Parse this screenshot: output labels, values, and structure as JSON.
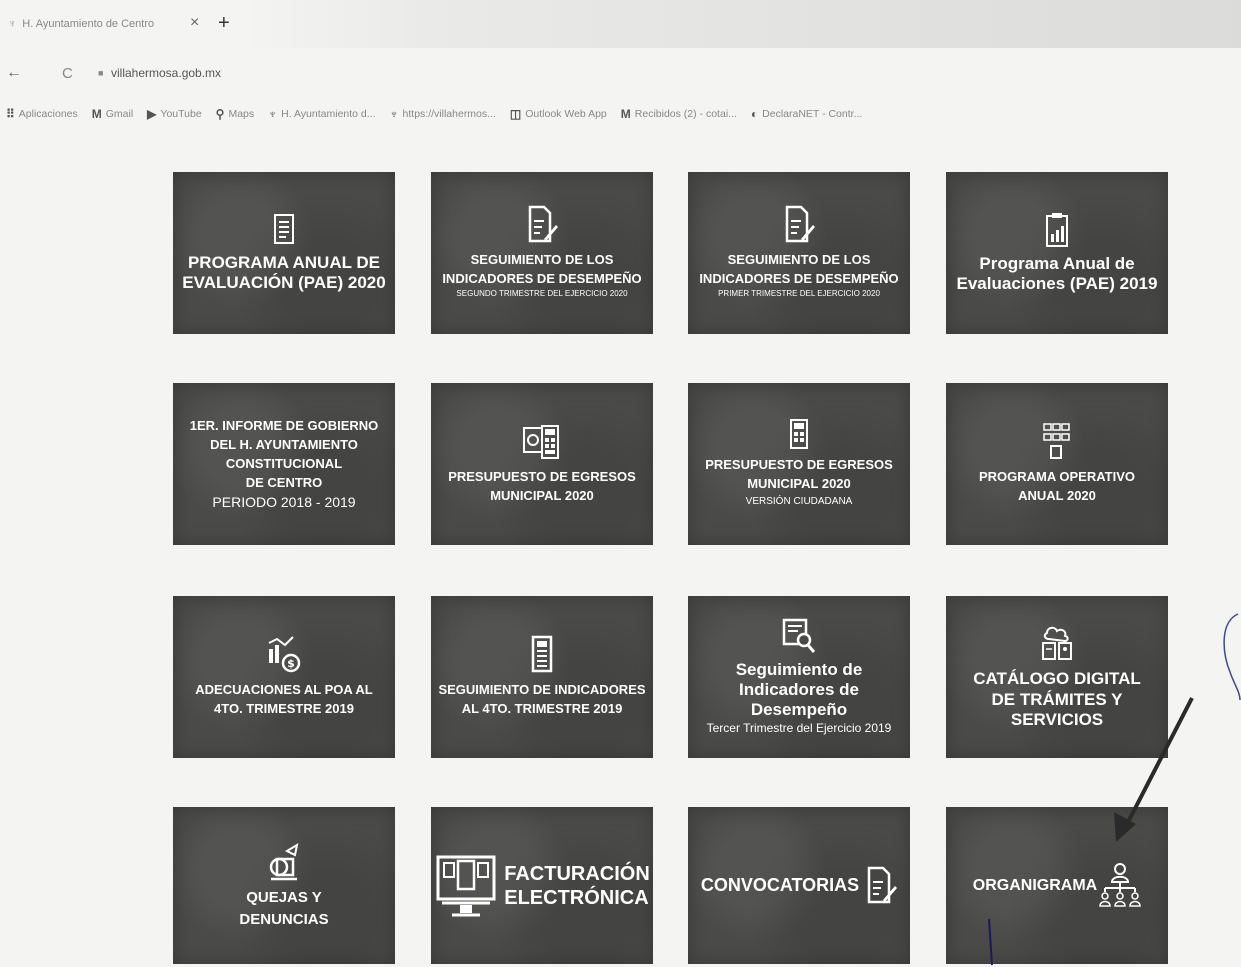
{
  "browser": {
    "tab_title": "H. Ayuntamiento de Centro",
    "tab_close": "×",
    "tab_new": "+",
    "back": "←",
    "reload": "C",
    "url": "villahermosa.gob.mx",
    "bookmarks": [
      {
        "icon": "⠿",
        "label": "Aplicaciones"
      },
      {
        "icon": "M",
        "label": "Gmail"
      },
      {
        "icon": "▶",
        "label": "YouTube"
      },
      {
        "icon": "⚲",
        "label": "Maps"
      },
      {
        "icon": "♆",
        "label": "H. Ayuntamiento d..."
      },
      {
        "icon": "♆",
        "label": "https://villahermos..."
      },
      {
        "icon": "◫",
        "label": "Outlook Web App"
      },
      {
        "icon": "M",
        "label": "Recibidos (2) - cotai..."
      },
      {
        "icon": "◐",
        "label": "DeclaraNET - Contr..."
      }
    ]
  },
  "tiles": {
    "t1": {
      "l1": "PROGRAMA ANUAL DE",
      "l2": "EVALUACIÓN (PAE) 2020"
    },
    "t2": {
      "l1": "SEGUIMIENTO DE LOS",
      "l2": "INDICADORES DE DESEMPEÑO",
      "l3": "SEGUNDO TRIMESTRE DEL EJERCICIO 2020"
    },
    "t3": {
      "l1": "SEGUIMIENTO DE LOS",
      "l2": "INDICADORES DE DESEMPEÑO",
      "l3": "PRIMER TRIMESTRE DEL EJERCICIO 2020"
    },
    "t4": {
      "l1": "Programa Anual de",
      "l2": "Evaluaciones (PAE) 2019"
    },
    "t5": {
      "l1": "1ER. INFORME DE GOBIERNO",
      "l2": "DEL H. AYUNTAMIENTO",
      "l3": "CONSTITUCIONAL",
      "l4": "DE CENTRO",
      "l5": "PERIODO 2018 - 2019"
    },
    "t6": {
      "l1": "PRESUPUESTO DE EGRESOS",
      "l2": "MUNICIPAL 2020"
    },
    "t7": {
      "l1": "PRESUPUESTO DE EGRESOS",
      "l2": "MUNICIPAL 2020",
      "l3": "VERSIÓN CIUDADANA"
    },
    "t8": {
      "l1": "PROGRAMA OPERATIVO",
      "l2": "ANUAL 2020"
    },
    "t9": {
      "l1": "ADECUACIONES AL POA AL",
      "l2": "4TO. TRIMESTRE 2019"
    },
    "t10": {
      "l1": "SEGUIMIENTO DE INDICADORES",
      "l2": "AL 4TO. TRIMESTRE 2019"
    },
    "t11": {
      "l1": "Seguimiento de",
      "l2": "Indicadores de Desempeño",
      "l3": "Tercer Trimestre del Ejercicio 2019"
    },
    "t12": {
      "l1": "CATÁLOGO DIGITAL",
      "l2": "DE TRÁMITES Y SERVICIOS"
    },
    "t13": {
      "l1": "QUEJAS Y",
      "l2": "DENUNCIAS"
    },
    "t14": {
      "l1": "FACTURACIÓN",
      "l2": "ELECTRÓNICA"
    },
    "t15": {
      "l1": "CONVOCATORIAS"
    },
    "t16": {
      "l1": "ORGANIGRAMA"
    }
  }
}
